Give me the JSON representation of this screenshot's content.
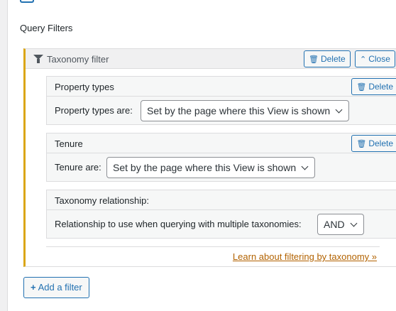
{
  "section": {
    "title": "Query Filters"
  },
  "filter": {
    "title": "Taxonomy filter",
    "icon": "funnel-icon",
    "delete_label": "Delete",
    "close_label": "Close"
  },
  "property_types": {
    "title": "Property types",
    "label": "Property types are:",
    "value": "Set by the page where this View is shown",
    "delete_label": "Delete"
  },
  "tenure": {
    "title": "Tenure",
    "label": "Tenure are:",
    "value": "Set by the page where this View is shown",
    "delete_label": "Delete"
  },
  "relationship": {
    "title": "Taxonomy relationship:",
    "label": "Relationship to use when querying with multiple taxonomies:",
    "value": "AND"
  },
  "learn_link": "Learn about filtering by taxonomy »",
  "add_filter_label": "Add a filter",
  "colors": {
    "accent": "#2271b1",
    "panel_border": "#dba617",
    "link": "#b26200"
  }
}
